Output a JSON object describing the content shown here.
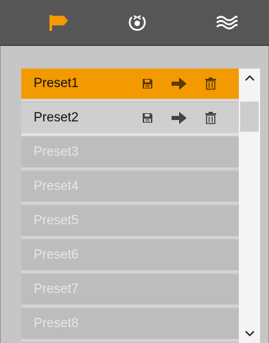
{
  "toolbar": {
    "tabs": [
      {
        "icon": "flag-icon",
        "active_color": "#f39a00"
      },
      {
        "icon": "ptz-cruise-icon"
      },
      {
        "icon": "pattern-waves-icon"
      }
    ]
  },
  "presets": [
    {
      "label": "Preset1",
      "state": "selected"
    },
    {
      "label": "Preset2",
      "state": "configured"
    },
    {
      "label": "Preset3",
      "state": "empty"
    },
    {
      "label": "Preset4",
      "state": "empty"
    },
    {
      "label": "Preset5",
      "state": "empty"
    },
    {
      "label": "Preset6",
      "state": "empty"
    },
    {
      "label": "Preset7",
      "state": "empty"
    },
    {
      "label": "Preset8",
      "state": "empty"
    }
  ],
  "row_actions": [
    "save-icon",
    "call-icon",
    "delete-icon"
  ],
  "colors": {
    "accent": "#f39a00",
    "toolbar_bg": "#565656"
  }
}
